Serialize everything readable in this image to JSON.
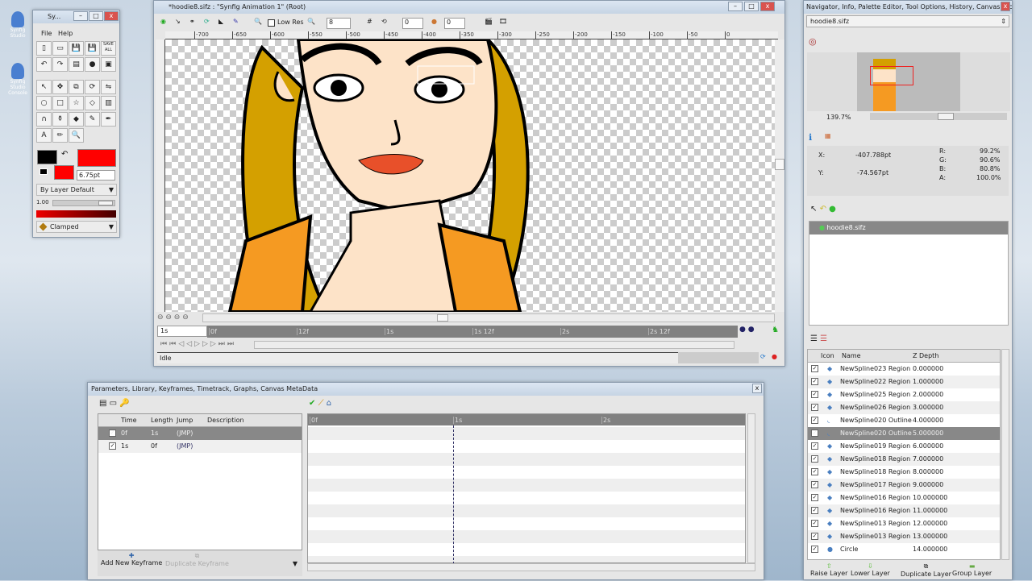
{
  "desktop": {
    "icons": [
      "Synfig Studio",
      "Synfig Studio Console"
    ]
  },
  "toolbox": {
    "title": "Sy...",
    "menu": [
      "File",
      "Help"
    ],
    "save_all": "SAVE ALL",
    "width": "6.75pt",
    "blend": "By Layer Default",
    "opacity": "1.00",
    "interp": "Clamped",
    "outline_color": "#000000",
    "fill_color": "#ff0000"
  },
  "canvas_win": {
    "title": "*hoodie8.sifz : \"Synfig Animation 1\" (Root)",
    "low_res": "Low Res",
    "grid_size": "8",
    "onion_past": "0",
    "onion_future": "0",
    "ruler": [
      "-700",
      "-650",
      "-600",
      "-550",
      "-500",
      "-450",
      "-400",
      "-350",
      "-300",
      "-250",
      "-200",
      "-150",
      "-100",
      "-50",
      "0"
    ],
    "time_field": "1s",
    "timeline": [
      "0f",
      "12f",
      "1s",
      "1s 12f",
      "2s",
      "2s 12f"
    ],
    "status": "Idle"
  },
  "params_panel": {
    "title": "Parameters, Library, Keyframes, Timetrack, Graphs, Canvas MetaData",
    "columns": [
      "Time",
      "Length",
      "Jump",
      "Description"
    ],
    "keyframes": [
      {
        "time": "0f",
        "length": "1s",
        "jump": "(JMP)",
        "description": ""
      },
      {
        "time": "1s",
        "length": "0f",
        "jump": "(JMP)",
        "description": ""
      }
    ],
    "add": "Add New Keyframe",
    "duplicate": "Duplicate Keyframe",
    "track_labels": [
      "0f",
      "1s",
      "2s"
    ]
  },
  "nav_panel": {
    "title": "Navigator, Info, Palette Editor, Tool Options, History, Canvas Brows...",
    "file": "hoodie8.sifz",
    "zoom": "139.7%",
    "x_label": "X:",
    "x": "-407.788pt",
    "y_label": "Y:",
    "y": "-74.567pt",
    "r_label": "R:",
    "r": "99.2%",
    "g_label": "G:",
    "g": "90.6%",
    "b_label": "B:",
    "b": "80.8%",
    "a_label": "A:",
    "a": "100.0%",
    "canvas_item": "hoodie8.sifz"
  },
  "layers": {
    "columns": [
      "Icon",
      "Name",
      "Z Depth"
    ],
    "rows": [
      {
        "name": "NewSpline023 Region",
        "z": "0.000000",
        "type": "region"
      },
      {
        "name": "NewSpline022 Region",
        "z": "1.000000",
        "type": "region"
      },
      {
        "name": "NewSpline025 Region",
        "z": "2.000000",
        "type": "region"
      },
      {
        "name": "NewSpline026 Region",
        "z": "3.000000",
        "type": "region"
      },
      {
        "name": "NewSpline020 Outline",
        "z": "4.000000",
        "type": "outline"
      },
      {
        "name": "NewSpline020 Outline",
        "z": "5.000000",
        "type": "outline",
        "selected": true
      },
      {
        "name": "NewSpline019 Region",
        "z": "6.000000",
        "type": "region"
      },
      {
        "name": "NewSpline018 Region",
        "z": "7.000000",
        "type": "region"
      },
      {
        "name": "NewSpline018 Region",
        "z": "8.000000",
        "type": "region"
      },
      {
        "name": "NewSpline017 Region",
        "z": "9.000000",
        "type": "region"
      },
      {
        "name": "NewSpline016 Region",
        "z": "10.000000",
        "type": "region"
      },
      {
        "name": "NewSpline016 Region",
        "z": "11.000000",
        "type": "region"
      },
      {
        "name": "NewSpline013 Region",
        "z": "12.000000",
        "type": "region"
      },
      {
        "name": "NewSpline013 Region",
        "z": "13.000000",
        "type": "region"
      },
      {
        "name": "Circle",
        "z": "14.000000",
        "type": "circle"
      }
    ],
    "buttons": [
      "Raise Layer",
      "Lower Layer",
      "Duplicate Layer",
      "Group Layer"
    ]
  }
}
